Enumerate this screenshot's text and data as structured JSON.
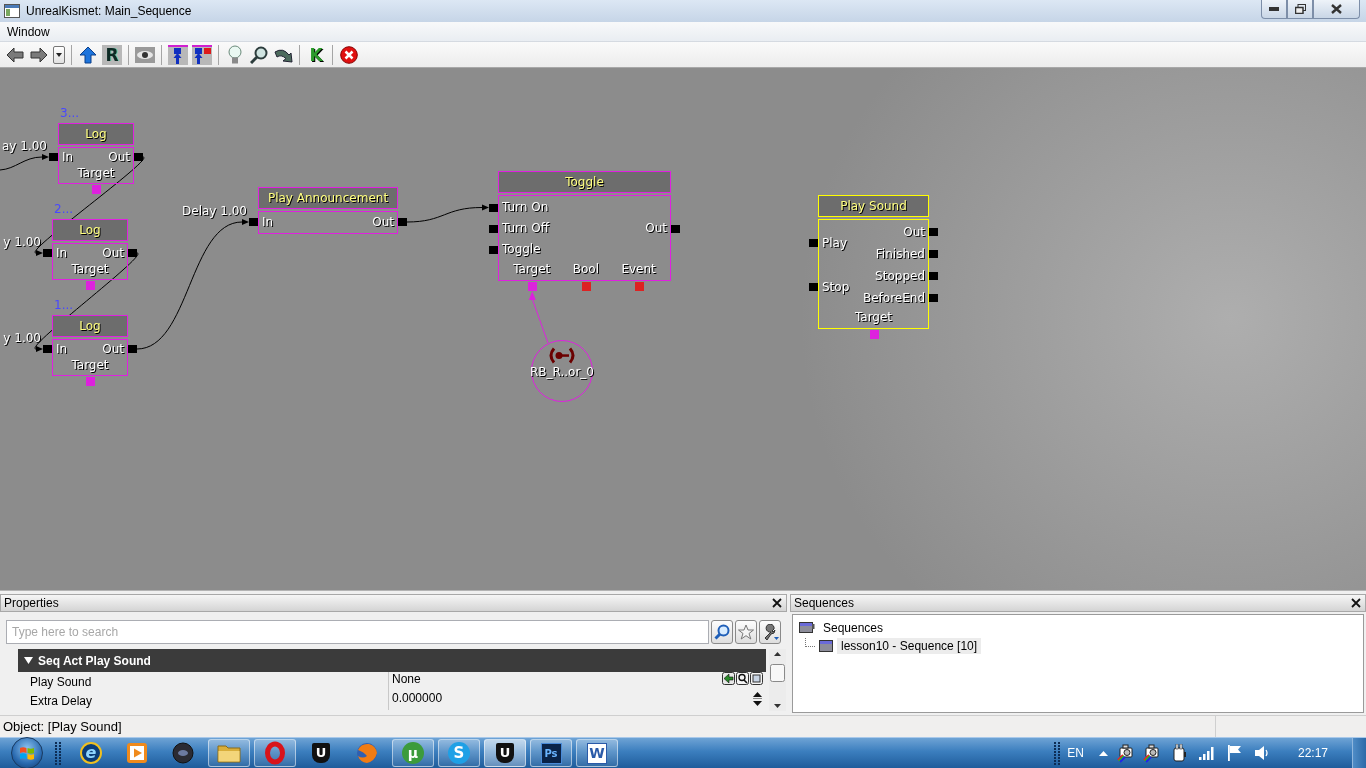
{
  "window": {
    "title": "UnrealKismet: Main_Sequence"
  },
  "menu": [
    "Window"
  ],
  "toolbar": [
    [
      {
        "kind": "back"
      },
      {
        "kind": "forward"
      },
      {
        "kind": "dropdown"
      }
    ],
    [
      {
        "kind": "up"
      },
      {
        "kind": "tile",
        "glyph": "R"
      }
    ],
    [
      {
        "kind": "eye"
      }
    ],
    [
      {
        "kind": "linkin"
      },
      {
        "kind": "linkvar"
      }
    ],
    [
      {
        "kind": "bulb"
      },
      {
        "kind": "zoom"
      },
      {
        "kind": "curve"
      }
    ],
    [
      {
        "kind": "glyph",
        "glyph": "K"
      }
    ],
    [
      {
        "kind": "stop"
      }
    ]
  ],
  "canvas": {
    "nodes": [
      {
        "comment": "3...",
        "title": "Log",
        "selected": false,
        "inputs": [
          {
            "label": "In",
            "delay": "ay 1.00"
          }
        ],
        "outputs": [
          {
            "label": "Out"
          }
        ],
        "variables": [
          {
            "label": "Target",
            "color": "#dd22dd"
          }
        ]
      },
      {
        "comment": "2...",
        "title": "Log",
        "selected": false,
        "inputs": [
          {
            "label": "In",
            "delay": "y 1.00"
          }
        ],
        "outputs": [
          {
            "label": "Out"
          }
        ],
        "variables": [
          {
            "label": "Target",
            "color": "#dd22dd"
          }
        ]
      },
      {
        "comment": "1...",
        "title": "Log",
        "selected": false,
        "inputs": [
          {
            "label": "In",
            "delay": "y 1.00"
          }
        ],
        "outputs": [
          {
            "label": "Out"
          }
        ],
        "variables": [
          {
            "label": "Target",
            "color": "#dd22dd"
          }
        ]
      },
      {
        "title": "Play Announcement",
        "selected": false,
        "inputs": [
          {
            "label": "In",
            "delay": "Delay 1.00"
          }
        ],
        "outputs": [
          {
            "label": "Out"
          }
        ]
      },
      {
        "title": "Toggle",
        "selected": false,
        "inputs": [
          {
            "label": "Turn On"
          },
          {
            "label": "Turn Off"
          },
          {
            "label": "Toggle"
          }
        ],
        "outputs": [
          {
            "label": "Out"
          }
        ],
        "variables": [
          {
            "label": "Target",
            "color": "#dd22dd"
          },
          {
            "label": "Bool",
            "color": "#dd2222"
          },
          {
            "label": "Event",
            "color": "#dd2222"
          }
        ]
      },
      {
        "title": "Play Sound",
        "selected": true,
        "inputs": [
          {
            "label": "Play"
          },
          {
            "label": "Stop"
          }
        ],
        "outputs": [
          {
            "label": "Out"
          },
          {
            "label": "Finished"
          },
          {
            "label": "Stopped"
          },
          {
            "label": "BeforeEnd"
          }
        ],
        "variables": [
          {
            "label": "Target",
            "color": "#dd22dd"
          }
        ]
      }
    ],
    "variables": [
      {
        "label": "RB_R..or_0"
      }
    ]
  },
  "properties": {
    "title": "Properties",
    "search": {
      "placeholder": "Type here to search"
    },
    "category": {
      "label": "Seq Act Play Sound",
      "expanded": true
    },
    "rows": [
      {
        "kind": "object",
        "name": "Play Sound",
        "value": "None"
      },
      {
        "kind": "number",
        "name": "Extra Delay",
        "value": "0.000000"
      }
    ]
  },
  "sequences": {
    "title": "Sequences",
    "tree": [
      {
        "label": "Sequences",
        "selected": false,
        "children": [
          {
            "label": "lesson10 - Sequence [10]",
            "selected": true
          }
        ]
      }
    ]
  },
  "status_bar": {
    "text": "Object: [Play Sound]"
  },
  "taskbar": {
    "items": [
      {
        "kind": "elogo",
        "glyph": "e",
        "running": false,
        "selected": false
      },
      {
        "kind": "play",
        "running": false,
        "selected": false
      },
      {
        "kind": "orb",
        "running": false,
        "selected": false
      },
      {
        "kind": "folder",
        "running": true,
        "selected": false
      },
      {
        "kind": "ring",
        "running": true,
        "selected": false
      },
      {
        "kind": "shield",
        "glyph": "U",
        "running": false,
        "selected": false
      },
      {
        "kind": "globe",
        "running": false,
        "selected": false
      },
      {
        "kind": "greendisc",
        "glyph": "µ",
        "running": true,
        "selected": false
      },
      {
        "kind": "bluedisc",
        "glyph": "S",
        "running": true,
        "selected": false
      },
      {
        "kind": "shield",
        "glyph": "U",
        "running": true,
        "selected": true
      },
      {
        "kind": "pstile",
        "glyph": "Ps",
        "running": true,
        "selected": false
      },
      {
        "kind": "doctile",
        "glyph": "W",
        "running": true,
        "selected": false
      }
    ],
    "language": "EN",
    "time": "22:17"
  }
}
